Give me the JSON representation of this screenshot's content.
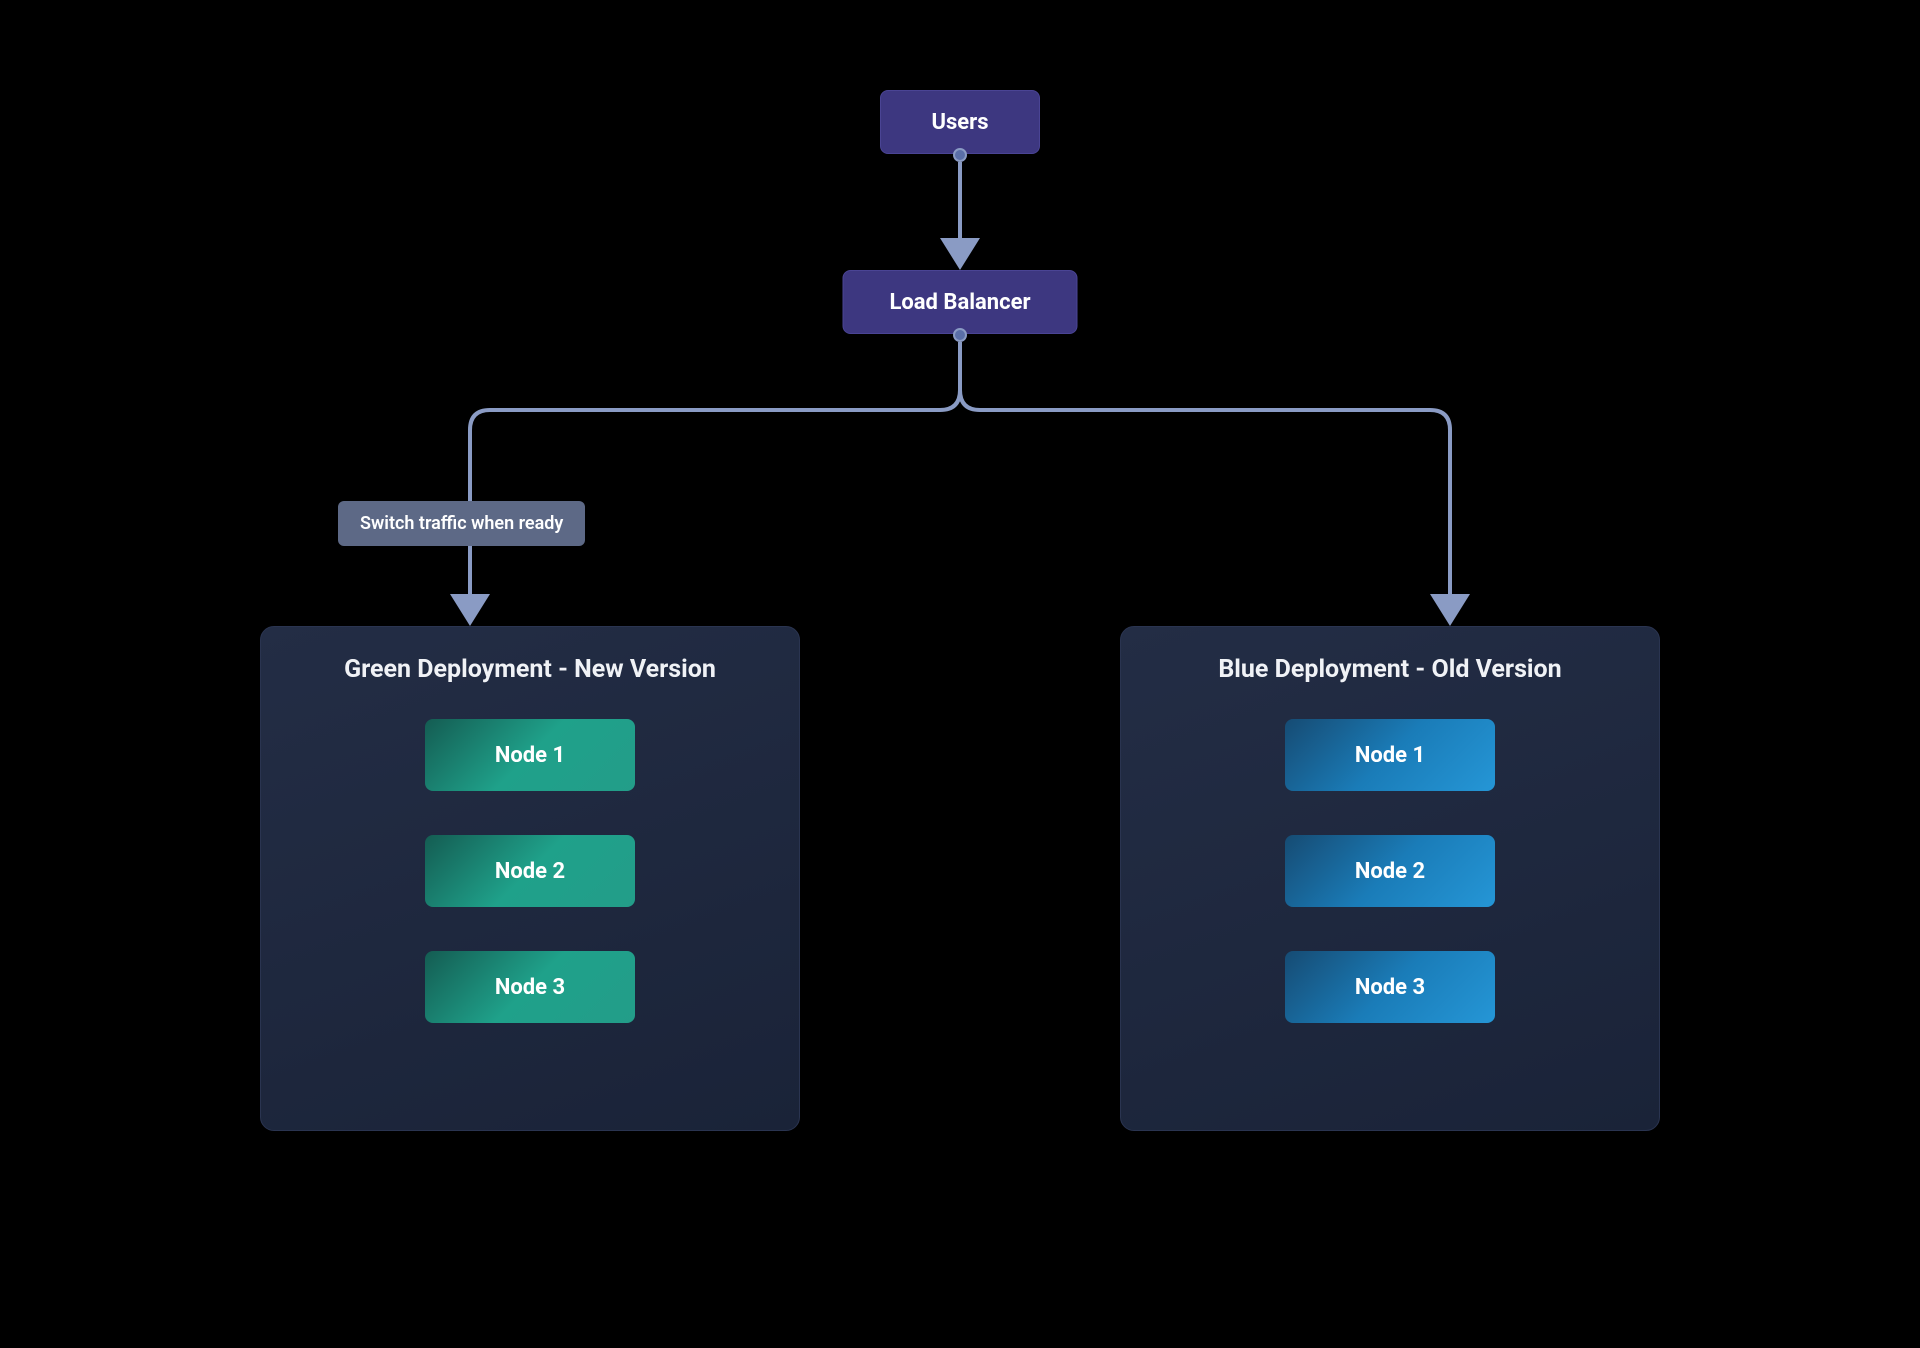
{
  "users": {
    "label": "Users"
  },
  "loadBalancer": {
    "label": "Load Balancer"
  },
  "edgeLabel": "Switch traffic when ready",
  "greenDeployment": {
    "title": "Green Deployment - New Version",
    "nodes": [
      "Node 1",
      "Node 2",
      "Node 3"
    ]
  },
  "blueDeployment": {
    "title": "Blue Deployment - Old Version",
    "nodes": [
      "Node 1",
      "Node 2",
      "Node 3"
    ]
  },
  "colors": {
    "background": "#000000",
    "nodeBox": "#3d3780",
    "edgeLabel": "#5d6986",
    "connector": "#8a9bc4",
    "deploymentBg": "#1e2740",
    "greenNode": "#1fa18a",
    "blueNode": "#1a7cb8"
  }
}
